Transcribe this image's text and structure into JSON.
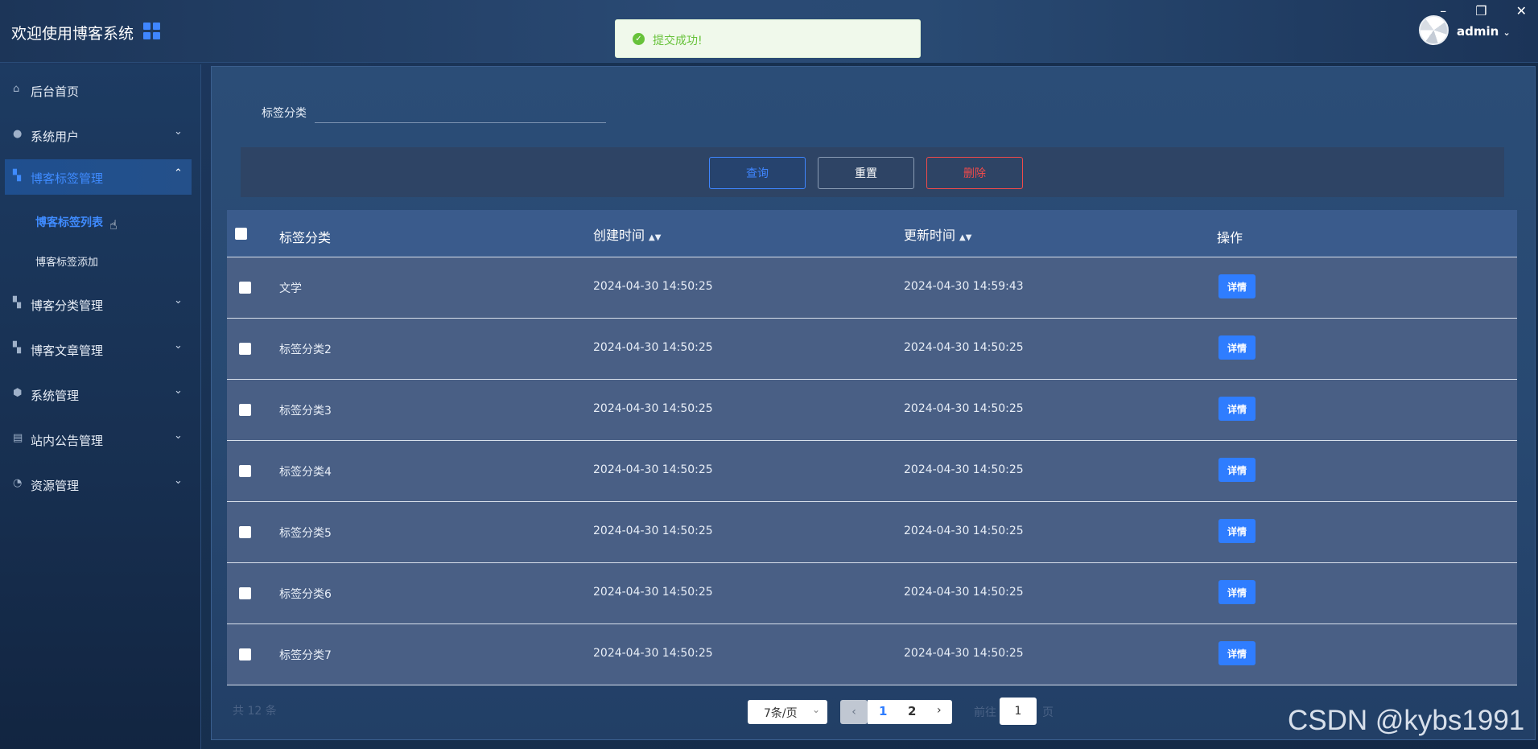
{
  "app": {
    "title": "欢迎使用博客系统",
    "user": "admin"
  },
  "toast": {
    "message": "提交成功!"
  },
  "sidebar": {
    "items": [
      {
        "label": "后台首页",
        "icon": "home-icon",
        "has_children": false
      },
      {
        "label": "系统用户",
        "icon": "user-icon",
        "has_children": true
      },
      {
        "label": "博客标签管理",
        "icon": "dashboard-icon",
        "has_children": true,
        "expanded": true
      },
      {
        "label": "博客分类管理",
        "icon": "dashboard-icon",
        "has_children": true
      },
      {
        "label": "博客文章管理",
        "icon": "dashboard-icon",
        "has_children": true
      },
      {
        "label": "系统管理",
        "icon": "settings-icon",
        "has_children": true
      },
      {
        "label": "站内公告管理",
        "icon": "notice-icon",
        "has_children": true
      },
      {
        "label": "资源管理",
        "icon": "pie-chart-icon",
        "has_children": true
      }
    ],
    "submenu": [
      {
        "label": "博客标签列表",
        "active": true
      },
      {
        "label": "博客标签添加",
        "active": false
      }
    ]
  },
  "search": {
    "label": "标签分类",
    "value": "",
    "placeholder": ""
  },
  "buttons": {
    "query": "查询",
    "reset": "重置",
    "delete": "删除"
  },
  "table": {
    "headers": {
      "name": "标签分类",
      "created": "创建时间",
      "updated": "更新时间",
      "action": "操作"
    },
    "detail_label": "详情",
    "rows": [
      {
        "name": "文学",
        "created": "2024-04-30 14:50:25",
        "updated": "2024-04-30 14:59:43"
      },
      {
        "name": "标签分类2",
        "created": "2024-04-30 14:50:25",
        "updated": "2024-04-30 14:50:25"
      },
      {
        "name": "标签分类3",
        "created": "2024-04-30 14:50:25",
        "updated": "2024-04-30 14:50:25"
      },
      {
        "name": "标签分类4",
        "created": "2024-04-30 14:50:25",
        "updated": "2024-04-30 14:50:25"
      },
      {
        "name": "标签分类5",
        "created": "2024-04-30 14:50:25",
        "updated": "2024-04-30 14:50:25"
      },
      {
        "name": "标签分类6",
        "created": "2024-04-30 14:50:25",
        "updated": "2024-04-30 14:50:25"
      },
      {
        "name": "标签分类7",
        "created": "2024-04-30 14:50:25",
        "updated": "2024-04-30 14:50:25"
      }
    ]
  },
  "pagination": {
    "total": "共 12 条",
    "page_size": "7条/页",
    "pages": [
      "1",
      "2"
    ],
    "current": "1",
    "goto_label": "前往",
    "goto_value": "1",
    "goto_suffix": "页"
  },
  "watermark": "CSDN @kybs1991"
}
